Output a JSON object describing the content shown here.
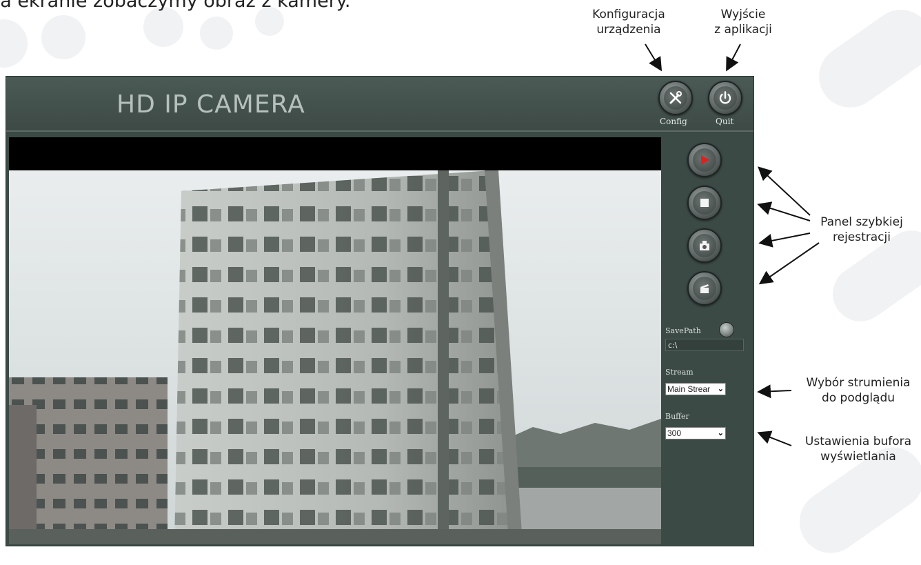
{
  "intro_text": "Na ekranie zobaczymy obraz z kamery.",
  "annotations": {
    "config": [
      "Konfiguracja",
      "urządzenia"
    ],
    "quit": [
      "Wyjście",
      "z aplikacji"
    ],
    "quick_panel": [
      "Panel szybkiej",
      "rejestracji"
    ],
    "stream": [
      "Wybór strumienia",
      "do podglądu"
    ],
    "buffer": [
      "Ustawienia bufora",
      "wyświetlania"
    ]
  },
  "app": {
    "title": "HD IP CAMERA",
    "config_label": "Config",
    "quit_label": "Quit"
  },
  "side_panel": {
    "save_path_label": "SavePath",
    "save_path_value": "c:\\",
    "stream_label": "Stream",
    "stream_value": "Main Strear",
    "buffer_label": "Buffer",
    "buffer_value": "300"
  },
  "icons": {
    "config": "wrench-screwdriver-icon",
    "quit": "power-icon",
    "play": "play-icon",
    "stop": "stop-icon",
    "snapshot": "camera-snapshot-icon",
    "record": "clapperboard-icon",
    "browse": "folder-browse-icon"
  },
  "colors": {
    "app_bg": "#3c4a46",
    "play_accent": "#e0201e"
  }
}
